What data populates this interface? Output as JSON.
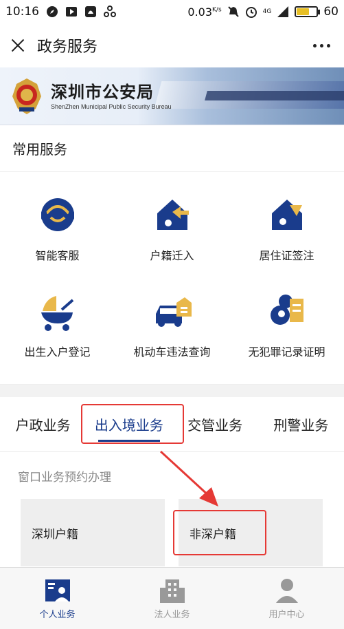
{
  "statusbar": {
    "time": "10:16",
    "speed": "0.03",
    "speed_unit": "K/s",
    "network": "4G",
    "battery": "60",
    "battery_level": 0.6
  },
  "header": {
    "title": "政务服务"
  },
  "banner": {
    "org_name": "深圳市公安局",
    "org_name_en": "ShenZhen Municipal Public Security Bureau"
  },
  "common_services": {
    "title": "常用服务",
    "items": [
      {
        "label": "智能客服",
        "icon": "headset-icon"
      },
      {
        "label": "户籍迁入",
        "icon": "household-move-in-icon"
      },
      {
        "label": "居住证签注",
        "icon": "residence-permit-icon"
      },
      {
        "label": "出生入户登记",
        "icon": "baby-stroller-icon"
      },
      {
        "label": "机动车违法查询",
        "icon": "car-violation-icon"
      },
      {
        "label": "无犯罪记录证明",
        "icon": "no-criminal-record-icon"
      }
    ]
  },
  "tabs": [
    {
      "label": "户政业务"
    },
    {
      "label": "出入境业务"
    },
    {
      "label": "交管业务"
    },
    {
      "label": "刑警业务"
    }
  ],
  "appointment": {
    "title": "窗口业务预约办理",
    "cards": [
      {
        "label": "深圳户籍"
      },
      {
        "label": "非深户籍"
      }
    ]
  },
  "bottom_nav": [
    {
      "label": "个人业务",
      "icon": "personal-icon"
    },
    {
      "label": "法人业务",
      "icon": "building-icon"
    },
    {
      "label": "用户中心",
      "icon": "user-icon"
    }
  ],
  "colors": {
    "primary": "#1a3c8c",
    "accent_yellow": "#e9b84a",
    "highlight_red": "#e53935"
  }
}
